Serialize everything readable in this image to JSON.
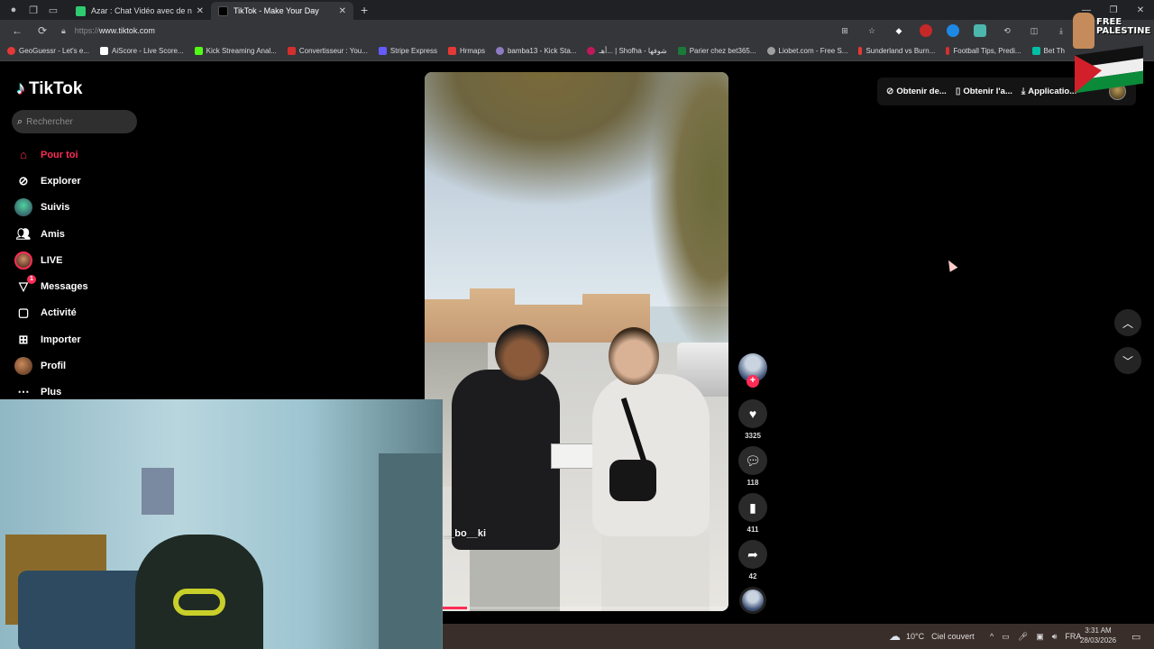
{
  "browser": {
    "tabs": [
      {
        "title": "Azar : Chat Vidéo avec de n",
        "active": false
      },
      {
        "title": "TikTok - Make Your Day",
        "active": true
      }
    ],
    "url_protocol": "https://",
    "url_host": "www.tiktok.com",
    "bookmarks": [
      {
        "label": "GeoGuessr - Let's e...",
        "color": "#e53935"
      },
      {
        "label": "AiScore - Live Score...",
        "color": "#ffffff"
      },
      {
        "label": "Kick Streaming Anal...",
        "color": "#53fc18"
      },
      {
        "label": "Convertisseur : You...",
        "color": "#d32f2f"
      },
      {
        "label": "Stripe Express",
        "color": "#635bff"
      },
      {
        "label": "Hrmaps",
        "color": "#e53935"
      },
      {
        "label": "bamba13 - Kick Sta...",
        "color": "#8e7cc3"
      },
      {
        "label": "أهـ... | Shofha - شوفها",
        "color": "#c2185b"
      },
      {
        "label": "Parier chez bet365...",
        "color": "#1b7a3a"
      },
      {
        "label": "Liobet.com - Free S...",
        "color": "#9e9e9e"
      },
      {
        "label": "Sunderland vs Burn...",
        "color": "#e53935"
      },
      {
        "label": "Football Tips, Predi...",
        "color": "#d32f2f"
      },
      {
        "label": "Bet Th",
        "color": "#00bfa5"
      }
    ],
    "sticker_text_line1": "FREE",
    "sticker_text_line2": "PALESTINE"
  },
  "tiktok": {
    "logo": "TikTok",
    "search_placeholder": "Rechercher",
    "menu": [
      {
        "label": "Pour toi",
        "icon": "home-icon",
        "active": true
      },
      {
        "label": "Explorer",
        "icon": "compass-icon",
        "active": false
      },
      {
        "label": "Suivis",
        "icon": "avatar",
        "active": false
      },
      {
        "label": "Amis",
        "icon": "friends-icon",
        "active": false
      },
      {
        "label": "LIVE",
        "icon": "live-avatar",
        "active": false
      },
      {
        "label": "Messages",
        "icon": "messages-icon",
        "active": false,
        "badge": "1"
      },
      {
        "label": "Activité",
        "icon": "activity-icon",
        "active": false
      },
      {
        "label": "Importer",
        "icon": "upload-icon",
        "active": false
      },
      {
        "label": "Profil",
        "icon": "profile-avatar",
        "active": false
      },
      {
        "label": "Plus",
        "icon": "more-icon",
        "active": false
      }
    ],
    "top_options": [
      {
        "label": "Obtenir de...",
        "icon": "coin-icon"
      },
      {
        "label": "Obtenir l'a...",
        "icon": "phone-icon"
      },
      {
        "label": "Applicatio...",
        "icon": "download-icon"
      }
    ],
    "video": {
      "author": "__bo__ki",
      "progress": 0.14
    },
    "actions": {
      "likes": "3325",
      "comments": "118",
      "saves": "411",
      "shares": "42"
    }
  },
  "taskbar": {
    "temperature": "10°C",
    "weather": "Ciel couvert",
    "language": "FRA",
    "time": "3:31 AM",
    "date": "28/03/2026"
  }
}
